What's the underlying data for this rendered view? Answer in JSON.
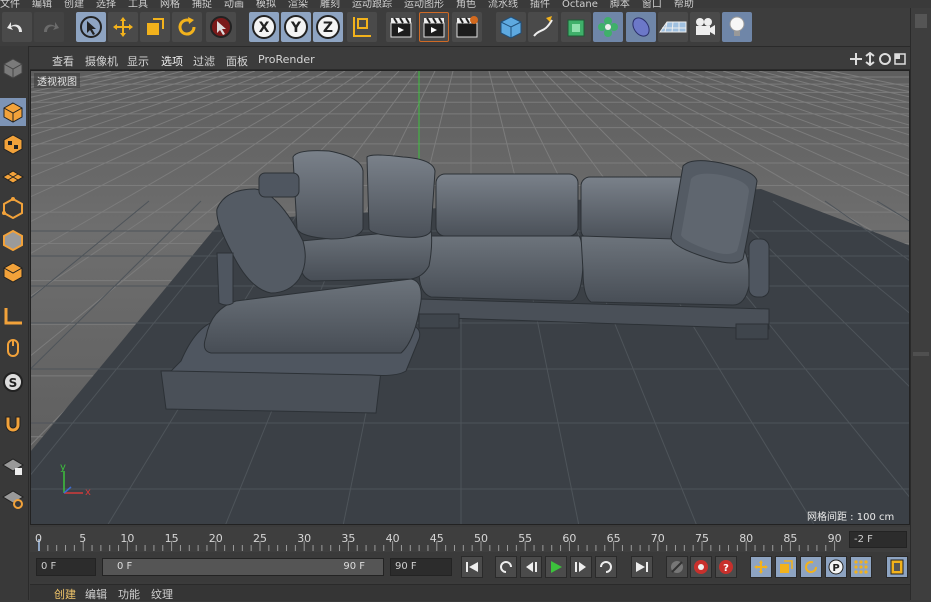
{
  "menubar": {
    "items": [
      "文件",
      "编辑",
      "创建",
      "选择",
      "工具",
      "网格",
      "捕捉",
      "动画",
      "模拟",
      "渲染",
      "雕刻",
      "运动跟踪",
      "运动图形",
      "角色",
      "流水线",
      "插件",
      "Octane",
      "脚本",
      "窗口",
      "帮助"
    ]
  },
  "viewport_menu": {
    "items": [
      "查看",
      "摄像机",
      "显示",
      "选项",
      "过滤",
      "面板",
      "ProRender"
    ]
  },
  "viewport": {
    "label": "透视视图",
    "grid_spacing": "网格间距 : 100 cm",
    "axis_x": "x",
    "axis_y": "y"
  },
  "timeline": {
    "ticks": [
      "0",
      "5",
      "10",
      "15",
      "20",
      "25",
      "30",
      "35",
      "40",
      "45",
      "50",
      "55",
      "60",
      "65",
      "70",
      "75",
      "80",
      "85",
      "90"
    ],
    "end_frame_field": "-2 F"
  },
  "transport": {
    "start_field": "0 F",
    "range_left": "0 F",
    "range_right": "90 F",
    "end_field": "90 F"
  },
  "bottom_tabs": [
    "创建",
    "编辑",
    "功能",
    "纹理"
  ],
  "colors": {
    "accent_blue": "#8ea4c2",
    "active_tab": "#f2c66a",
    "sofa": "#4a5058",
    "floor": "#3a3f44"
  },
  "icons": {
    "undo": "undo-icon",
    "redo": "redo-icon",
    "select": "arrow-cursor-icon",
    "move": "move-icon",
    "scale": "scale-icon",
    "rotate": "rotate-icon",
    "x_axis": "X",
    "y_axis": "Y",
    "z_axis": "Z"
  }
}
